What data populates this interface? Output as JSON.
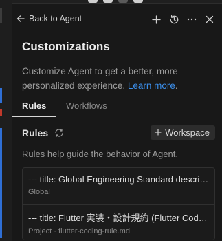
{
  "header": {
    "back_label": "Back to Agent",
    "icons": [
      "add-icon",
      "history-icon",
      "more-icon",
      "close-icon"
    ]
  },
  "page": {
    "title": "Customizations",
    "description": "Customize Agent to get a better, more personalized experience.",
    "learn_more": "Learn more",
    "period": "."
  },
  "tabs": [
    {
      "label": "Rules",
      "active": true
    },
    {
      "label": "Workflows",
      "active": false
    }
  ],
  "rules": {
    "title": "Rules",
    "add_button_label": "Workspace",
    "help_text": "Rules help guide the behavior of Agent.",
    "items": [
      {
        "title": "--- title: Global Engineering Standard description: ...",
        "subtitle": "Global"
      },
      {
        "title": "--- title: Flutter 実装・設計規約 (Flutter Coding Rule) ...",
        "subtitle": "Project · flutter-coding-rule.md"
      }
    ]
  },
  "colors": {
    "background": "#181818",
    "link": "#3b8eea",
    "accent_marks": [
      "#2f6fd6",
      "#c0392b"
    ]
  }
}
